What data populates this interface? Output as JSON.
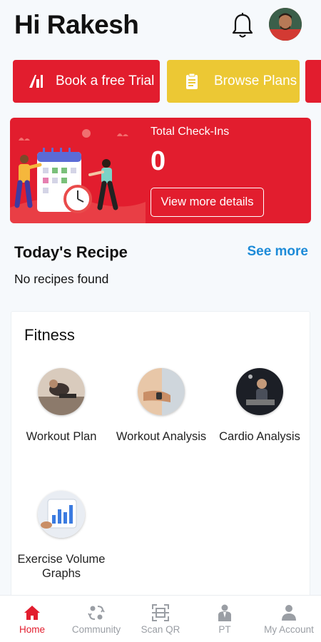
{
  "header": {
    "greeting": "Hi Rakesh"
  },
  "actions": {
    "trial_label": "Book a free Trial",
    "plans_label": "Browse Plans"
  },
  "checkins": {
    "label": "Total Check-Ins",
    "count": "0",
    "details_label": "View more details"
  },
  "recipe": {
    "title": "Today's Recipe",
    "see_more": "See more",
    "empty": "No recipes found"
  },
  "fitness": {
    "title": "Fitness",
    "items": [
      {
        "label": "Workout Plan",
        "icon": "workout-plan-photo"
      },
      {
        "label": "Workout Analysis",
        "icon": "workout-analysis-photo"
      },
      {
        "label": "Cardio Analysis",
        "icon": "cardio-analysis-photo"
      },
      {
        "label": "Exercise Volume Graphs",
        "icon": "exercise-volume-photo"
      }
    ]
  },
  "nav": {
    "items": [
      {
        "label": "Home",
        "icon": "home-icon",
        "active": true
      },
      {
        "label": "Community",
        "icon": "community-icon"
      },
      {
        "label": "Scan QR",
        "icon": "scan-qr-icon"
      },
      {
        "label": "PT",
        "icon": "pt-icon"
      },
      {
        "label": "My Account",
        "icon": "account-icon"
      }
    ]
  },
  "colors": {
    "brand_red": "#e21d2e",
    "yellow": "#ecc834",
    "link_blue": "#1d8bd8"
  }
}
